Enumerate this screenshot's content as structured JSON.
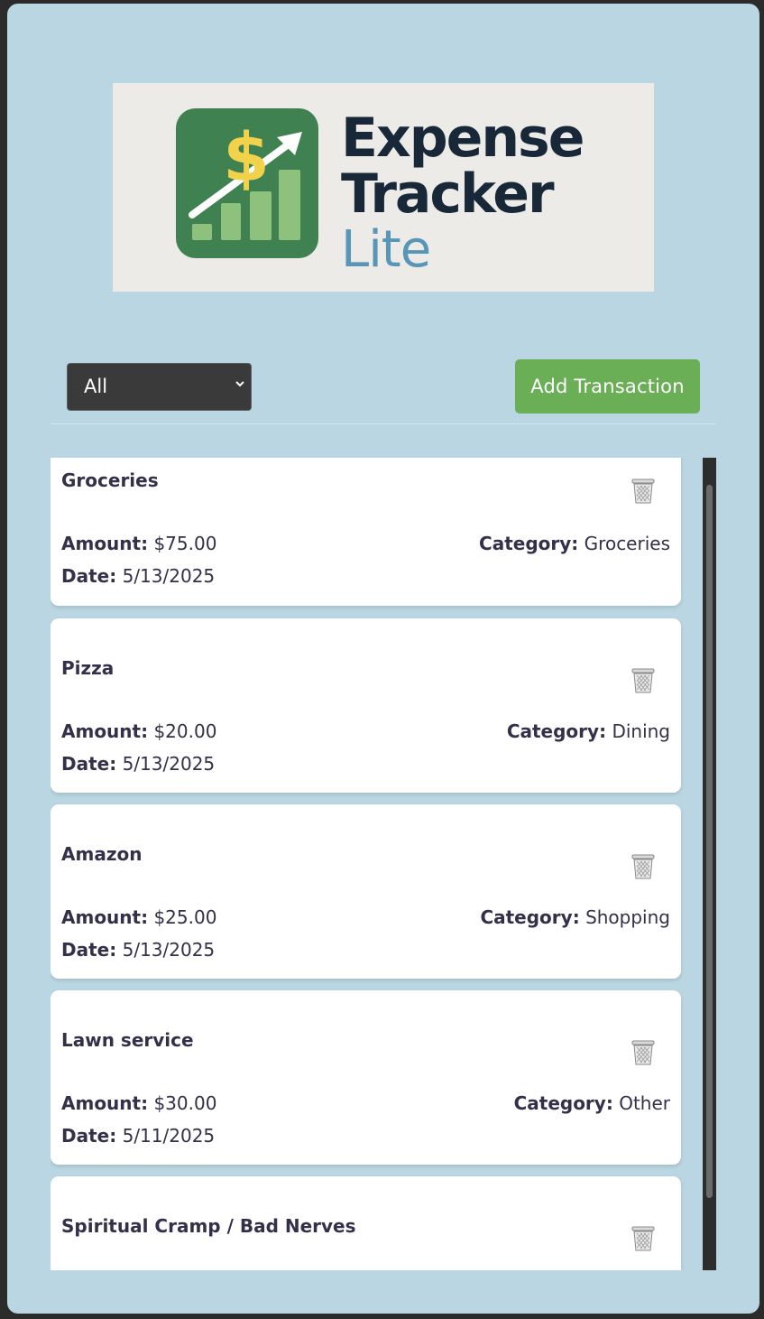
{
  "logo": {
    "line1": "Expense",
    "line2": "Tracker",
    "line3": "Lite",
    "icon": "dollar-chart-icon",
    "colors": {
      "icon_bg": "#3f8150",
      "bars": "#8ec27c",
      "dollar": "#f2d24a",
      "dark_text": "#182839",
      "lite_text": "#5796b6"
    }
  },
  "toolbar": {
    "filter_value": "All",
    "add_label": "Add Transaction",
    "add_color": "#6aae56"
  },
  "labels": {
    "amount": "Amount:",
    "date": "Date:",
    "category": "Category:"
  },
  "transactions": [
    {
      "title": "Groceries",
      "amount": "$75.00",
      "date": "5/13/2025",
      "category": "Groceries"
    },
    {
      "title": "Pizza",
      "amount": "$20.00",
      "date": "5/13/2025",
      "category": "Dining"
    },
    {
      "title": "Amazon",
      "amount": "$25.00",
      "date": "5/13/2025",
      "category": "Shopping"
    },
    {
      "title": "Lawn service",
      "amount": "$30.00",
      "date": "5/11/2025",
      "category": "Other"
    },
    {
      "title": "Spiritual Cramp / Bad Nerves",
      "amount": "",
      "date": "",
      "category": ""
    }
  ],
  "icons": {
    "delete": "trash-icon"
  }
}
